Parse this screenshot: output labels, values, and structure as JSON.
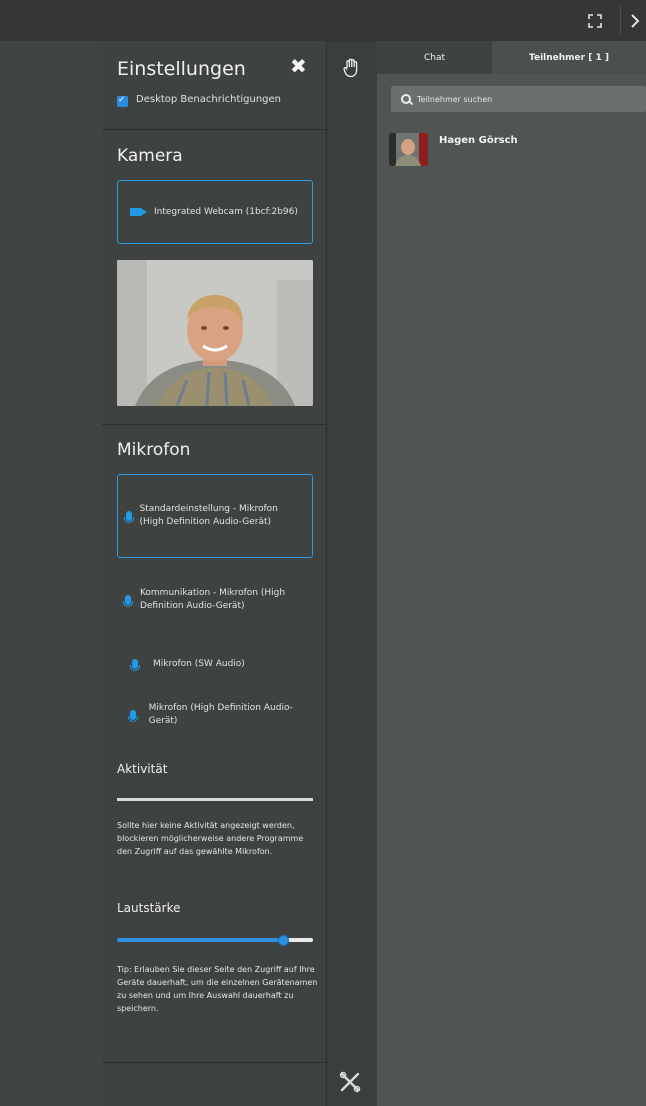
{
  "settings": {
    "title": "Einstellungen",
    "desktop_notifications_label": "Desktop Benachrichtigungen",
    "camera_title": "Kamera",
    "camera_device": "Integrated Webcam (1bcf:2b96)",
    "mic_title": "Mikrofon",
    "mic_devices": [
      "Standardeinstellung - Mikrofon (High Definition Audio-Gerät)",
      "Kommunikation - Mikrofon (High Definition Audio-Gerät)",
      "Mikrofon (SW Audio)",
      "Mikrofon (High Definition Audio-Gerät)"
    ],
    "activity_title": "Aktivität",
    "activity_text": "Sollte hier keine Aktivität angezeigt werden, blockieren möglicherweise andere Programme den Zugriff auf das gewählte Mikrofon.",
    "volume_title": "Lautstärke",
    "volume_level_fraction": 0.86,
    "tip_text": "Tip: Erlauben Sie dieser Seite den Zugriff auf Ihre Geräte dauerhaft, um die einzelnen Gerätenamen zu sehen und um Ihre Auswahl dauerhaft zu speichern."
  },
  "tabs": {
    "chat": "Chat",
    "participants": "Teilnehmer [ 1 ]"
  },
  "search": {
    "placeholder": "Teilnehmer suchen"
  },
  "participants": [
    {
      "name": "Hagen Görsch"
    }
  ],
  "colors": {
    "accent": "#2f9de0",
    "panel_bg": "#3e4240",
    "participants_bg": "#4f5552"
  },
  "icons": [
    "expand-icon",
    "chevron-right-icon",
    "close-icon",
    "checkbox-icon",
    "webcam-icon",
    "microphone-icon",
    "raise-hand-icon",
    "tools-icon",
    "search-icon"
  ]
}
